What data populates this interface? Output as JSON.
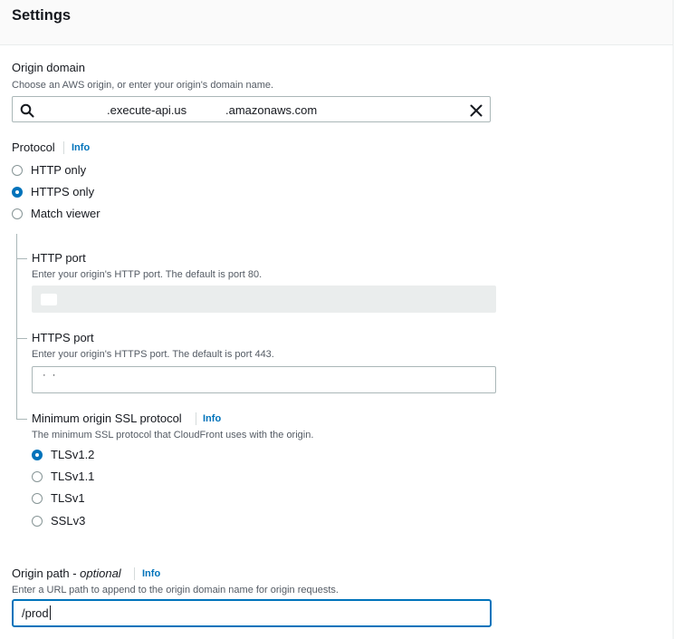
{
  "header": {
    "title": "Settings"
  },
  "origin_domain": {
    "label": "Origin domain",
    "description": "Choose an AWS origin, or enter your origin's domain name.",
    "value_part1": ".execute-api.us",
    "value_part2": ".amazonaws.com",
    "search_icon": "search-icon",
    "clear_icon": "close-icon"
  },
  "protocol": {
    "label": "Protocol",
    "info": "Info",
    "options": [
      {
        "label": "HTTP only",
        "checked": false
      },
      {
        "label": "HTTPS only",
        "checked": true
      },
      {
        "label": "Match viewer",
        "checked": false
      }
    ]
  },
  "http_port": {
    "label": "HTTP port",
    "description": "Enter your origin's HTTP port. The default is port 80."
  },
  "https_port": {
    "label": "HTTPS port",
    "description": "Enter your origin's HTTPS port. The default is port 443.",
    "value": "· ·"
  },
  "ssl": {
    "label": "Minimum origin SSL protocol",
    "info": "Info",
    "description": "The minimum SSL protocol that CloudFront uses with the origin.",
    "options": [
      {
        "label": "TLSv1.2",
        "checked": true
      },
      {
        "label": "TLSv1.1",
        "checked": false
      },
      {
        "label": "TLSv1",
        "checked": false
      },
      {
        "label": "SSLv3",
        "checked": false
      }
    ]
  },
  "origin_path": {
    "label_main": "Origin path - ",
    "label_optional": "optional",
    "info": "Info",
    "description": "Enter a URL path to append to the origin domain name for origin requests.",
    "value": "/prod"
  },
  "colors": {
    "accent": "#0073bb",
    "text": "#16191f",
    "muted": "#545b64",
    "border": "#aab7b8"
  }
}
